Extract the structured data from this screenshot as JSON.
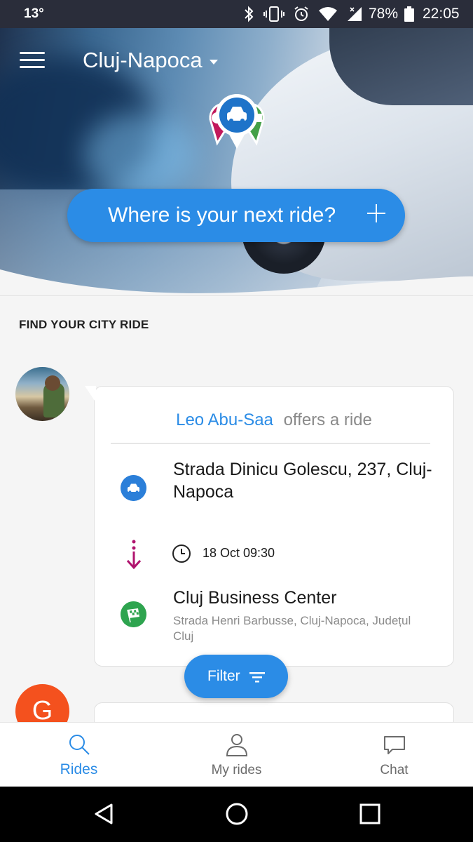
{
  "status_bar": {
    "temperature": "13°",
    "battery": "78%",
    "time": "22:05"
  },
  "header": {
    "city": "Cluj-Napoca",
    "next_ride_label": "Where is your next ride?"
  },
  "section_title": "FIND YOUR CITY RIDE",
  "ride": {
    "driver": "Leo Abu-Saa",
    "action": "offers a ride",
    "from": "Strada Dinicu Golescu, 237, Cluj-Napoca",
    "departure": "18 Oct 09:30",
    "to_name": "Cluj Business Center",
    "to_address": "Strada Henri Barbusse, Cluj-Napoca, Județul Cluj"
  },
  "next_ride_avatar_letter": "G",
  "filter_label": "Filter",
  "nav": {
    "items": [
      {
        "label": "Rides",
        "icon": "search-icon",
        "active": true
      },
      {
        "label": "My rides",
        "icon": "person-icon",
        "active": false
      },
      {
        "label": "Chat",
        "icon": "chat-icon",
        "active": false
      }
    ]
  },
  "colors": {
    "accent": "#2b8ce6",
    "destination": "#2ea44f",
    "arrow": "#b0146e",
    "avatar_g": "#f4511e"
  }
}
